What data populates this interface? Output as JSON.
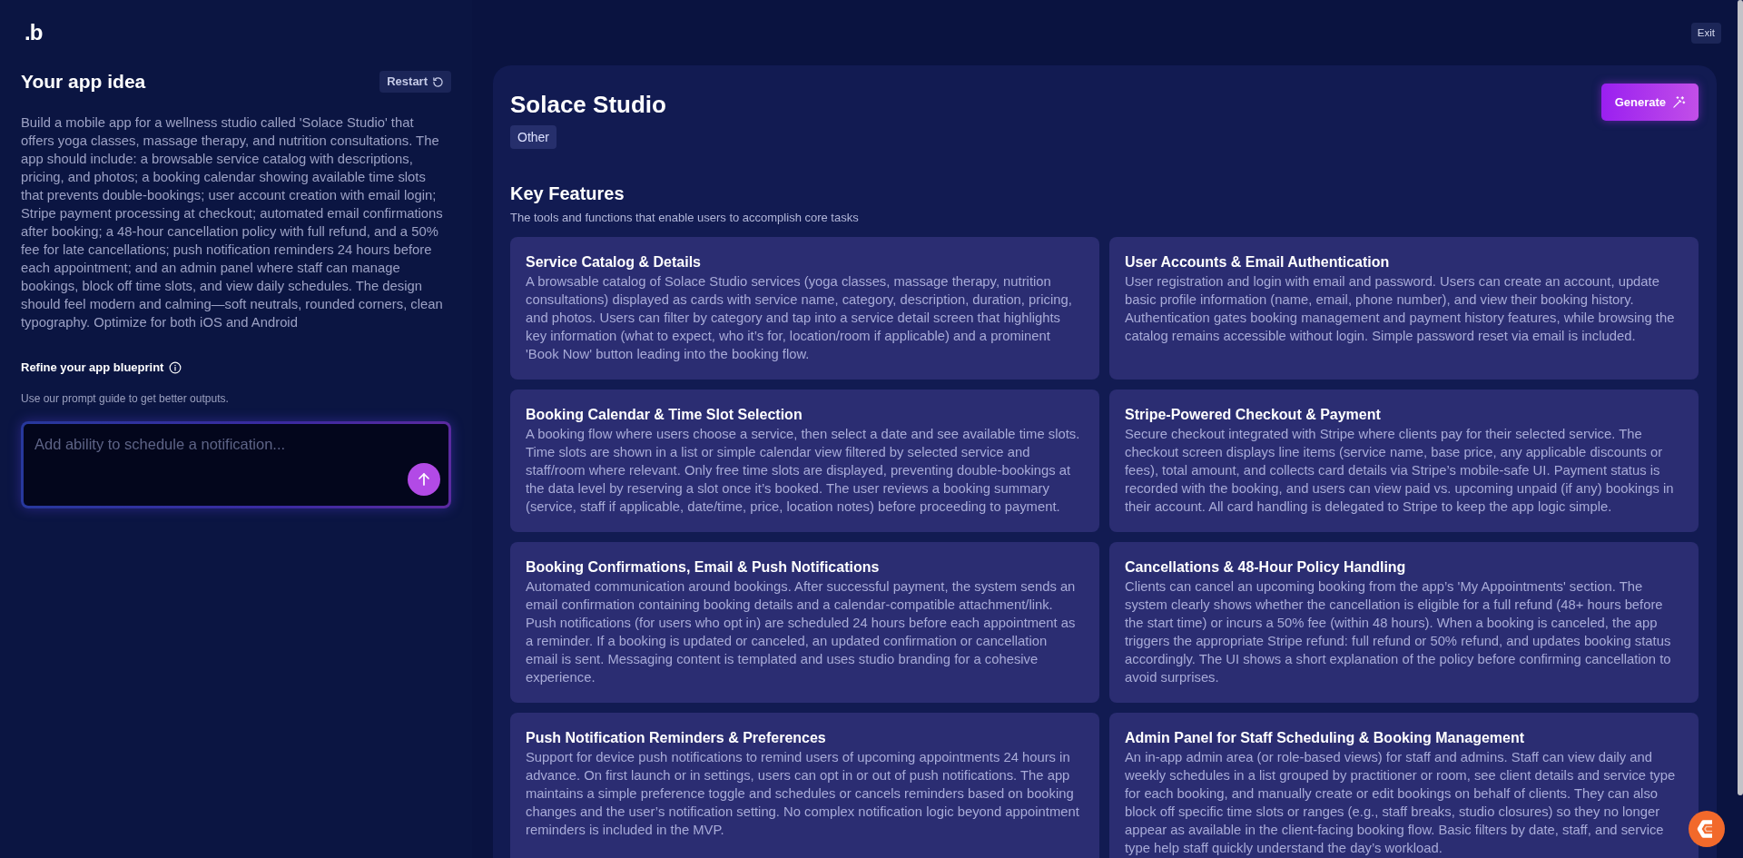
{
  "logo": {
    "text": ".b"
  },
  "top_bar": {
    "exit_button": "Exit"
  },
  "idea_panel": {
    "title": "Your app idea",
    "restart_button": "Restart",
    "description": "Build a mobile app for a wellness studio called 'Solace Studio' that offers yoga classes, massage therapy, and nutrition consultations. The app should include: a browsable service catalog with descriptions, pricing, and photos; a booking calendar showing available time slots that prevents double-bookings; user account creation with email login; Stripe payment processing at checkout; automated email confirmations after booking; a 48-hour cancellation policy with full refund, and a 50% fee for late cancellations; push notification reminders 24 hours before each appointment; and an admin panel where staff can manage bookings, block off time slots, and view daily schedules. The design should feel modern and calming—soft neutrals, rounded corners, clean typography. Optimize for both iOS and Android",
    "refine": {
      "title": "Refine your app blueprint",
      "hint": "Use our prompt guide to get better outputs.",
      "prompt_input": {
        "placeholder": "Add ability to schedule a notification..."
      }
    }
  },
  "blueprint": {
    "name": "Solace Studio",
    "category": "Other",
    "generate_button": "Generate",
    "key_features": {
      "title": "Key Features",
      "subtitle": "The tools and functions that enable users to accomplish core tasks",
      "features": [
        {
          "title": "Service Catalog & Details",
          "description": "A browsable catalog of Solace Studio services (yoga classes, massage therapy, nutrition consultations) displayed as cards with service name, category, description, duration, pricing, and photos. Users can filter by category and tap into a service detail screen that highlights key information (what to expect, who it’s for, location/room if applicable) and a prominent 'Book Now' button leading into the booking flow."
        },
        {
          "title": "User Accounts & Email Authentication",
          "description": "User registration and login with email and password. Users can create an account, update basic profile information (name, email, phone number), and view their booking history. Authentication gates booking management and payment history features, while browsing the catalog remains accessible without login. Simple password reset via email is included."
        },
        {
          "title": "Booking Calendar & Time Slot Selection",
          "description": "A booking flow where users choose a service, then select a date and see available time slots. Time slots are shown in a list or simple calendar view filtered by selected service and staff/room where relevant. Only free time slots are displayed, preventing double-bookings at the data level by reserving a slot once it’s booked. The user reviews a booking summary (service, staff if applicable, date/time, price, location notes) before proceeding to payment."
        },
        {
          "title": "Stripe-Powered Checkout & Payment",
          "description": "Secure checkout integrated with Stripe where clients pay for their selected service. The checkout screen displays line items (service name, base price, any applicable discounts or fees), total amount, and collects card details via Stripe’s mobile-safe UI. Payment status is recorded with the booking, and users can view paid vs. upcoming unpaid (if any) bookings in their account. All card handling is delegated to Stripe to keep the app logic simple."
        },
        {
          "title": "Booking Confirmations, Email & Push Notifications",
          "description": "Automated communication around bookings. After successful payment, the system sends an email confirmation containing booking details and a calendar-compatible attachment/link. Push notifications (for users who opt in) are scheduled 24 hours before each appointment as a reminder. If a booking is updated or canceled, an updated confirmation or cancellation email is sent. Messaging content is templated and uses studio branding for a cohesive experience."
        },
        {
          "title": "Cancellations & 48-Hour Policy Handling",
          "description": "Clients can cancel an upcoming booking from the app’s 'My Appointments' section. The system clearly shows whether the cancellation is eligible for a full refund (48+ hours before the start time) or incurs a 50% fee (within 48 hours). When a booking is canceled, the app triggers the appropriate Stripe refund: full refund or 50% refund, and updates booking status accordingly. The UI shows a short explanation of the policy before confirming cancellation to avoid surprises."
        },
        {
          "title": "Push Notification Reminders & Preferences",
          "description": "Support for device push notifications to remind users of upcoming appointments 24 hours in advance. On first launch or in settings, users can opt in or out of push notifications. The app maintains a simple preference toggle and schedules or cancels reminders based on booking changes and the user’s notification setting. No complex notification logic beyond appointment reminders is included in the MVP."
        },
        {
          "title": "Admin Panel for Staff Scheduling & Booking Management",
          "description": "An in-app admin area (or role-based views) for staff and admins. Staff can view daily and weekly schedules in a list grouped by practitioner or room, see client details and service type for each booking, and manually create or edit bookings on behalf of clients. They can also block off specific time slots or ranges (e.g., staff breaks, studio closures) so they no longer appear as available in the client-facing booking flow. Basic filters by date, staff, and service type help staff quickly understand the day’s workload."
        }
      ]
    }
  }
}
